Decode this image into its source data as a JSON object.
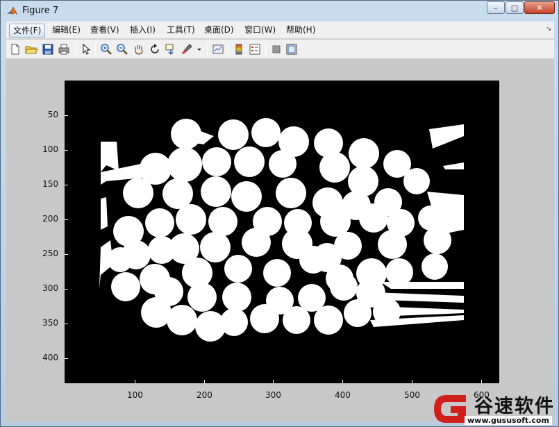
{
  "window": {
    "title": "Figure 7",
    "minimize": "–",
    "maximize": "□",
    "close": "✕"
  },
  "menu": [
    {
      "label": "文件(F)"
    },
    {
      "label": "编辑(E)"
    },
    {
      "label": "查看(V)"
    },
    {
      "label": "插入(I)"
    },
    {
      "label": "工具(T)"
    },
    {
      "label": "桌面(D)"
    },
    {
      "label": "窗口(W)"
    },
    {
      "label": "帮助(H)"
    }
  ],
  "toolbar_icons": [
    "new-figure-icon",
    "open-file-icon",
    "save-icon",
    "print-icon",
    "edit-plot-arrow-icon",
    "zoom-in-icon",
    "zoom-out-icon",
    "pan-hand-icon",
    "rotate-3d-icon",
    "data-cursor-icon",
    "brush-icon",
    "link-plot-icon",
    "colorbar-icon",
    "legend-icon",
    "hide-plot-tools-icon",
    "show-plot-tools-icon"
  ],
  "axes": {
    "y_ticks": [
      "50",
      "100",
      "150",
      "200",
      "250",
      "300",
      "350",
      "400"
    ],
    "x_ticks": [
      "100",
      "200",
      "300",
      "400",
      "500",
      "600"
    ]
  },
  "image": {
    "background": "#000000",
    "foreground": "#ffffff"
  },
  "watermark": {
    "text": "谷速软件",
    "url": "www.gususoft.com",
    "color": "#d0201c"
  }
}
